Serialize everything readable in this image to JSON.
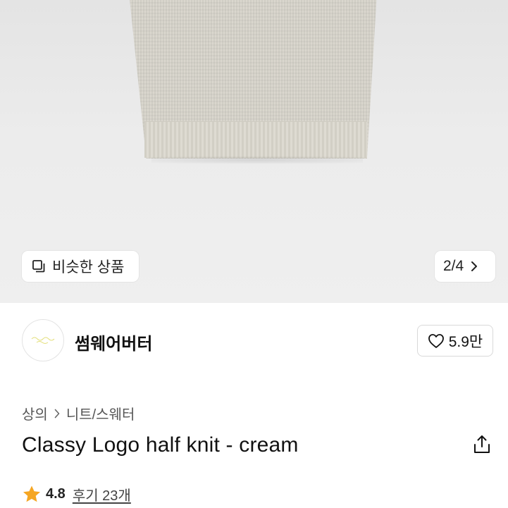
{
  "hero": {
    "image_alt": "cream knit hem",
    "similar_label": "비슷한 상품",
    "page_counter": "2/4"
  },
  "store": {
    "name": "썸웨어버터",
    "likes": "5.9만"
  },
  "breadcrumb": {
    "level1": "상의",
    "level2": "니트/스웨터"
  },
  "product": {
    "title": "Classy Logo half knit - cream"
  },
  "rating": {
    "score": "4.8",
    "reviews": "후기 23개"
  },
  "colors": {
    "star": "#F5A623",
    "hero_bg": "#ECECEC",
    "knit": "#D8D5CC"
  }
}
